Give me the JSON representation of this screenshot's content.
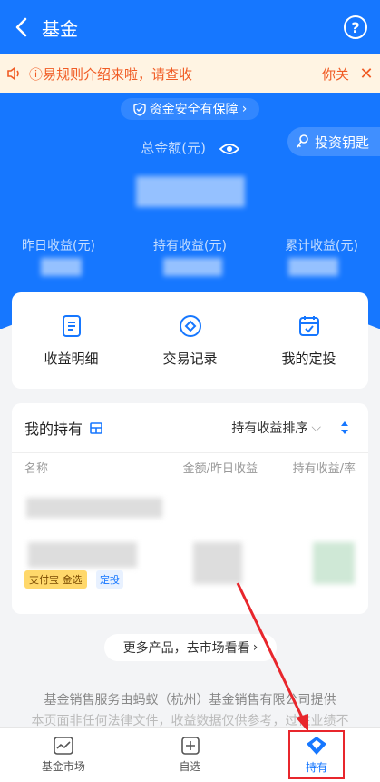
{
  "header": {
    "title": "基金"
  },
  "notice": {
    "text": "ⓘ易规则介绍来啦，请查收",
    "action": "你关"
  },
  "hero": {
    "safety": "资金安全有保障",
    "total_label": "总金额(元)",
    "key_button": "投资钥匙",
    "stats": [
      "昨日收益(元)",
      "持有收益(元)",
      "累计收益(元)"
    ]
  },
  "quick": [
    {
      "label": "收益明细",
      "icon": "document-icon"
    },
    {
      "label": "交易记录",
      "icon": "diamond-circle-icon"
    },
    {
      "label": "我的定投",
      "icon": "calendar-check-icon"
    }
  ],
  "holdings": {
    "title": "我的持有",
    "sort": "持有收益排序",
    "col_name": "名称",
    "col_amount": "金额/昨日收益",
    "col_profit": "持有收益/率",
    "tag_gold": "支付宝 金选",
    "tag_plan": "定投"
  },
  "more": "更多产品，去市场看看",
  "footer": {
    "line1": "基金销售服务由蚂蚁（杭州）基金销售有限公司提供",
    "line2": "本页面非任何法律文件，收益数据仅供参考，过往业绩不"
  },
  "tabs": [
    {
      "label": "基金市场",
      "icon": "chart-window-icon"
    },
    {
      "label": "自选",
      "icon": "plus-square-icon"
    },
    {
      "label": "持有",
      "icon": "holding-icon"
    }
  ],
  "colors": {
    "primary": "#1677ff",
    "notice": "#f05b24",
    "highlight": "#e8262c"
  }
}
